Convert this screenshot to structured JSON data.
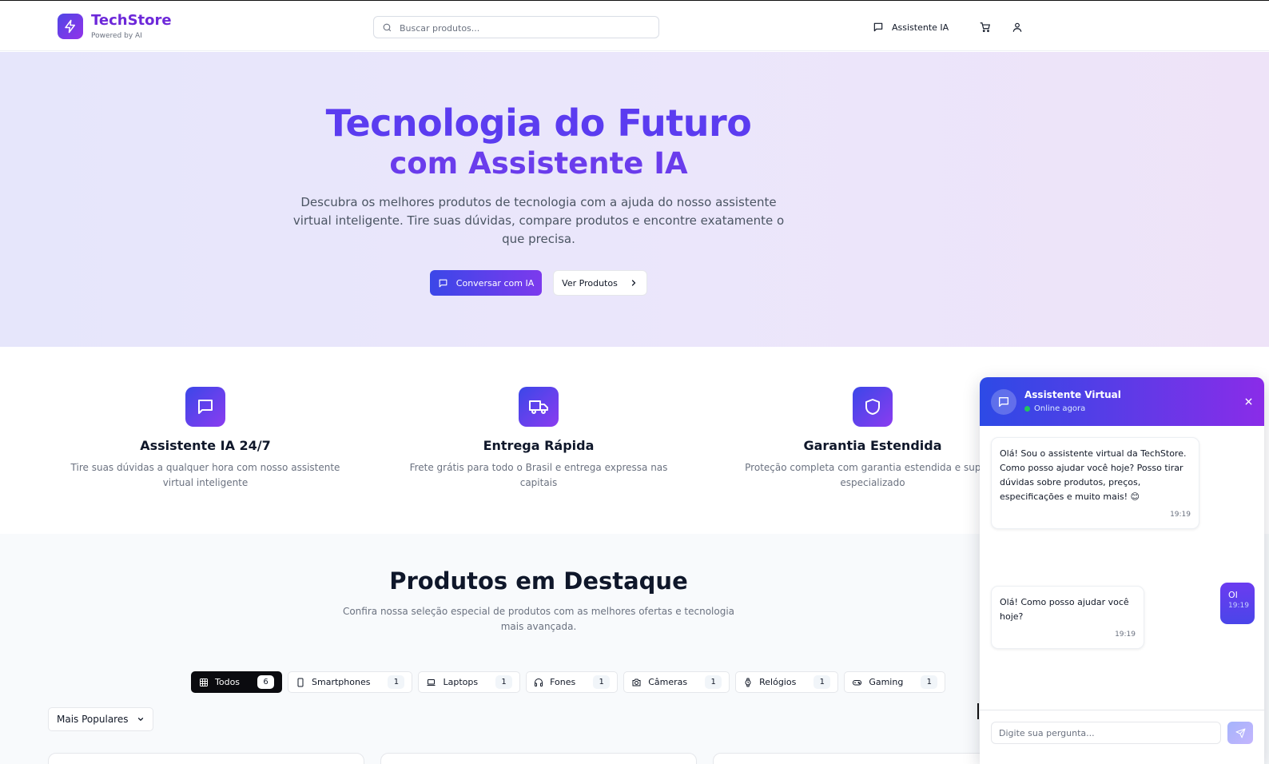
{
  "header": {
    "brand": "TechStore",
    "brand_sub": "Powered by AI",
    "search_placeholder": "Buscar produtos...",
    "nav_ai_label": "Assistente IA",
    "icons": [
      "zap-icon",
      "search-icon",
      "message-icon",
      "cart-icon",
      "user-icon"
    ]
  },
  "hero": {
    "title": "Tecnologia do Futuro",
    "title2": "com Assistente IA",
    "description": "Descubra os melhores produtos de tecnologia com a ajuda do nosso assistente virtual inteligente. Tire suas dúvidas, compare produtos e encontre exatamente o que precisa.",
    "primary_button": "Conversar com IA",
    "secondary_button": "Ver Produtos"
  },
  "features": [
    {
      "icon": "message-icon",
      "title": "Assistente IA 24/7",
      "description": "Tire suas dúvidas a qualquer hora com nosso assistente virtual inteligente"
    },
    {
      "icon": "truck-icon",
      "title": "Entrega Rápida",
      "description": "Frete grátis para todo o Brasil e entrega expressa nas capitais"
    },
    {
      "icon": "shield-icon",
      "title": "Garantia Estendida",
      "description": "Proteção completa com garantia estendida e suporte especializado"
    }
  ],
  "products": {
    "title": "Produtos em Destaque",
    "subtitle": "Confira nossa seleção especial de produtos com as melhores ofertas e tecnologia mais avançada.",
    "categories": [
      {
        "label": "Todos",
        "count": "6",
        "icon": "grid-icon",
        "active": true
      },
      {
        "label": "Smartphones",
        "count": "1",
        "icon": "smartphone-icon"
      },
      {
        "label": "Laptops",
        "count": "1",
        "icon": "laptop-icon"
      },
      {
        "label": "Fones",
        "count": "1",
        "icon": "headphones-icon"
      },
      {
        "label": "Câmeras",
        "count": "1",
        "icon": "camera-icon"
      },
      {
        "label": "Relógios",
        "count": "1",
        "icon": "watch-icon"
      },
      {
        "label": "Gaming",
        "count": "1",
        "icon": "gamepad-icon"
      }
    ],
    "sort_selected": "Mais Populares"
  },
  "chat": {
    "title": "Assistente Virtual",
    "status": "Online agora",
    "messages": [
      {
        "from": "bot",
        "text": "Olá! Sou o assistente virtual da TechStore. Como posso ajudar você hoje? Posso tirar dúvidas sobre produtos, preços, especificações e muito mais! 😊",
        "time": "19:19"
      },
      {
        "from": "user",
        "text": "OI",
        "time": "19:19"
      },
      {
        "from": "bot",
        "text": "Olá! Como posso ajudar você hoje?",
        "time": "19:19"
      }
    ],
    "input_placeholder": "Digite sua pergunta..."
  },
  "colors": {
    "accent": "#5b3cf0",
    "gradient_start": "#3b47e8",
    "gradient_end": "#8b3cf0",
    "online": "#22c55e"
  }
}
